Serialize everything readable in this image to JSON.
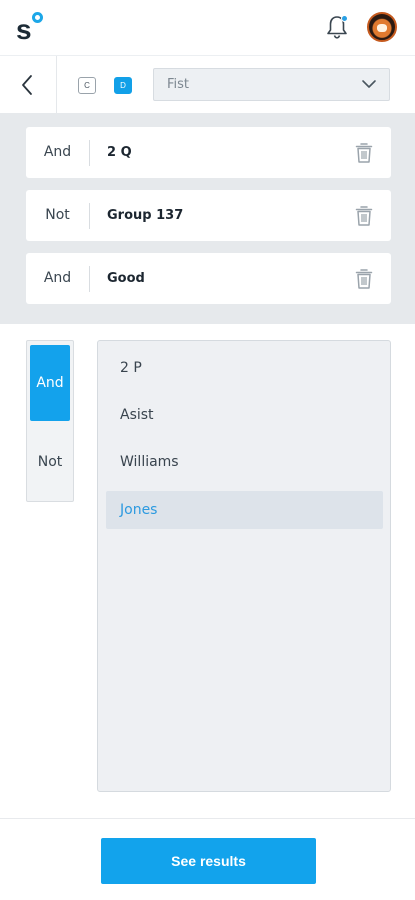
{
  "header": {
    "logo_letter": "s",
    "bell_icon": "bell-icon",
    "avatar_icon": "avatar"
  },
  "subbar": {
    "back_icon": "chevron-left-icon",
    "modes": [
      {
        "label": "C",
        "active": false
      },
      {
        "label": "D",
        "active": true
      }
    ],
    "dropdown_value": "Fist",
    "dropdown_icon": "chevron-down-icon"
  },
  "filters": [
    {
      "operator": "And",
      "name": "2 Q"
    },
    {
      "operator": "Not",
      "name": "Group 137"
    },
    {
      "operator": "And",
      "name": "Good"
    }
  ],
  "operator_picker": {
    "options": [
      "And",
      "Not"
    ],
    "selected": "And"
  },
  "list": {
    "items": [
      "2 P",
      "Asist",
      "Williams",
      "Jones"
    ],
    "selected": "Jones"
  },
  "footer": {
    "cta_label": "See results"
  },
  "colors": {
    "accent": "#12a3ec",
    "panel_bg": "#e6e9ec",
    "selected_text": "#2c9ae0"
  }
}
